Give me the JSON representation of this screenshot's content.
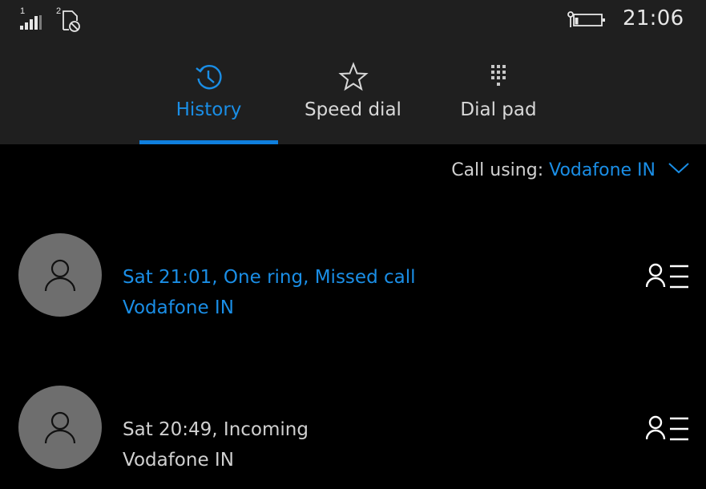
{
  "status_bar": {
    "sim1_label": "1",
    "sim2_label": "2",
    "sim1_icon": "signal-bars-icon",
    "sim2_icon": "sim-card-blocked-icon",
    "battery_icon": "battery-charging-icon",
    "time": "21:06"
  },
  "tabs": [
    {
      "label": "History",
      "icon": "history-clock-icon",
      "active": true
    },
    {
      "label": "Speed dial",
      "icon": "star-icon",
      "active": false
    },
    {
      "label": "Dial pad",
      "icon": "dialpad-icon",
      "active": false
    }
  ],
  "call_using": {
    "label": "Call using:",
    "value": "Vodafone IN",
    "icon": "chevron-down-icon"
  },
  "history": [
    {
      "line1": "Sat 21:01, One ring, Missed call",
      "line2": "Vodafone IN",
      "missed": true,
      "avatar_icon": "person-icon",
      "action_icon": "contact-details-icon"
    },
    {
      "line1": "Sat 20:49, Incoming",
      "line2": "Vodafone IN",
      "missed": false,
      "avatar_icon": "person-icon",
      "action_icon": "contact-details-icon"
    }
  ],
  "colors": {
    "accent": "#1a8ee6",
    "header_bg": "#1f1f1f",
    "background": "#000000",
    "avatar_bg": "#6e6e6e"
  }
}
